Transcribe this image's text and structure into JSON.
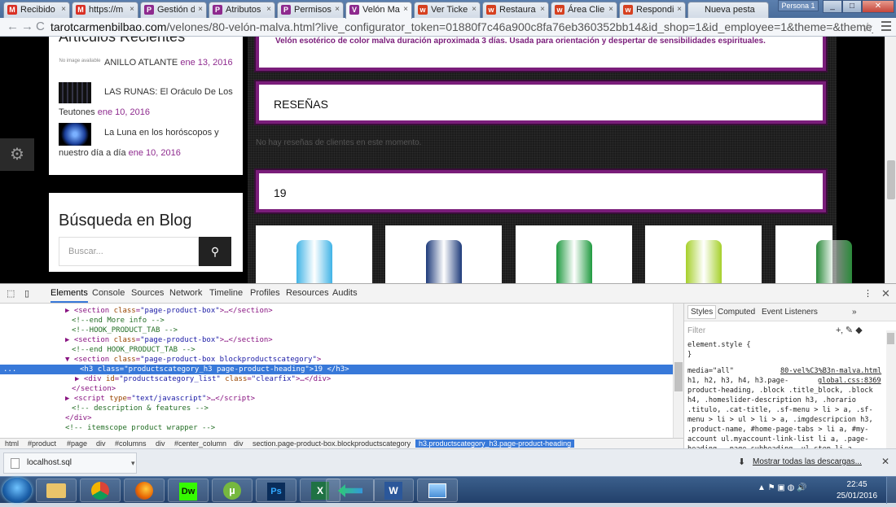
{
  "browser": {
    "tabs": [
      {
        "icon": "gmail-icon",
        "label": "Recibido",
        "color": "#d93025",
        "glyph": "M"
      },
      {
        "icon": "gmail-icon",
        "label": "https://m",
        "color": "#d93025",
        "glyph": "M"
      },
      {
        "icon": "prestashop-icon",
        "label": "Gestión d",
        "color": "#8e2a8e",
        "glyph": "P"
      },
      {
        "icon": "prestashop-icon",
        "label": "Atributos",
        "color": "#8e2a8e",
        "glyph": "P"
      },
      {
        "icon": "prestashop-icon",
        "label": "Permisos",
        "color": "#8e2a8e",
        "glyph": "P"
      },
      {
        "icon": "prestashop-icon",
        "label": "Velón Ma",
        "color": "#8e2a8e",
        "glyph": "V"
      },
      {
        "icon": "wix-icon",
        "label": "Ver Ticke",
        "color": "#d6401f",
        "glyph": "w"
      },
      {
        "icon": "wix-icon",
        "label": "Restaura",
        "color": "#d6401f",
        "glyph": "w"
      },
      {
        "icon": "wix-icon",
        "label": "Área Clie",
        "color": "#d6401f",
        "glyph": "w"
      },
      {
        "icon": "wix-icon",
        "label": "Respondi",
        "color": "#d6401f",
        "glyph": "w"
      },
      {
        "icon": "",
        "label": "Nueva pesta",
        "color": "",
        "glyph": ""
      }
    ],
    "profile": "Persona 1",
    "url_host": "tarotcarmenbilbao.com",
    "url_path": "/velones/80-velón-malva.html?live_configurator_token=01880f7c46a900c8fa76eb360352bb14&id_shop=1&id_employee=1&theme=&theme_fon"
  },
  "page": {
    "blog_heading_cut": "Artículos Recientes",
    "posts": [
      {
        "thumb": "No image available",
        "title": "ANILLO ATLANTE",
        "date": "ene 13, 2016"
      },
      {
        "thumb": "",
        "title": "LAS RUNAS: El Oráculo De Los Teutones",
        "date": "ene 10, 2016"
      },
      {
        "thumb": "",
        "title": "La Luna en los horóscopos y nuestro día a día",
        "date": "ene 10, 2016"
      }
    ],
    "search_title": "Búsqueda en Blog",
    "search_placeholder": "Buscar...",
    "description": "Velón esotérico de color malva duración aproximada 3 días. Usada para orientación y despertar de sensibilidades espirituales.",
    "reviews_heading": "RESEÑAS",
    "no_reviews": "No hay reseñas de clientes en este momento.",
    "category_count_heading": "19",
    "products": [
      {
        "color": "#3fb3e6"
      },
      {
        "color": "#1d3a7a"
      },
      {
        "color": "#1f9a3f"
      },
      {
        "color": "#a6d02a"
      },
      {
        "color": "#2a8a3a"
      }
    ]
  },
  "devtools": {
    "tabs": [
      "Elements",
      "Console",
      "Sources",
      "Network",
      "Timeline",
      "Profiles",
      "Resources",
      "Audits"
    ],
    "active_tab": "Elements",
    "dom_lines": [
      {
        "indent": 80,
        "html": "▶ <span class='tag'>&lt;section</span> <span class='attr'>class</span>=<span class='val'>\"page-product-box\"</span><span class='tag'>&gt;</span>…<span class='tag'>&lt;/section&gt;</span>"
      },
      {
        "indent": 88,
        "html": "<span class='c'>&lt;!--end  More info --&gt;</span>"
      },
      {
        "indent": 88,
        "html": "<span class='c'>&lt;!--HOOK_PRODUCT_TAB --&gt;</span>"
      },
      {
        "indent": 80,
        "html": "▶ <span class='tag'>&lt;section</span> <span class='attr'>class</span>=<span class='val'>\"page-product-box\"</span><span class='tag'>&gt;</span>…<span class='tag'>&lt;/section&gt;</span>"
      },
      {
        "indent": 88,
        "html": "<span class='c'>&lt;!--end HOOK_PRODUCT_TAB --&gt;</span>"
      },
      {
        "indent": 80,
        "html": "▼ <span class='tag'>&lt;section</span> <span class='attr'>class</span>=<span class='val'>\"page-product-box blockproductscategory\"</span><span class='tag'>&gt;</span>"
      },
      {
        "indent": 98,
        "html": "<span class='tag'>&lt;h3</span> <span class='attr'>class</span>=<span class='val'>\"productscategory_h3 page-product-heading\"</span><span class='tag'>&gt;</span><span class='txtn'>19 </span><span class='tag'>&lt;/h3&gt;</span>",
        "selected": true
      },
      {
        "indent": 92,
        "html": "▶ <span class='tag'>&lt;div</span> <span class='attr'>id</span>=<span class='val'>\"productscategory_list\"</span> <span class='attr'>class</span>=<span class='val'>\"clearfix\"</span><span class='tag'>&gt;</span>…<span class='tag'>&lt;/div&gt;</span>"
      },
      {
        "indent": 88,
        "html": "<span class='tag'>&lt;/section&gt;</span>"
      },
      {
        "indent": 80,
        "html": "▶ <span class='tag'>&lt;script</span> <span class='attr'>type</span>=<span class='val'>\"text/javascript\"</span><span class='tag'>&gt;</span>…<span class='tag'>&lt;/script&gt;</span>"
      },
      {
        "indent": 88,
        "html": "<span class='c'>&lt;!-- description &amp; features --&gt;</span>"
      },
      {
        "indent": 80,
        "html": "<span class='tag'>&lt;/div&gt;</span>"
      },
      {
        "indent": 80,
        "html": "<span class='c'>&lt;!-- itemscope product wrapper --&gt;</span>"
      }
    ],
    "breadcrumbs": [
      "html",
      "#product",
      "#page",
      "div",
      "#columns",
      "div",
      "#center_column",
      "div",
      "section.page-product-box.blockproductscategory",
      "h3.productscategory_h3.page-product-heading"
    ],
    "styles_tabs": [
      "Styles",
      "Computed",
      "Event Listeners"
    ],
    "filter_placeholder": "Filter",
    "style_lines": [
      "element.style {",
      "}",
      "media=\"all\"",
      "h1, h2, h3, h4, h3.page-",
      "product-heading, .block .title_block, .block",
      "h4, .homeslider-description h3, .horario",
      ".titulo, .cat-title, .sf-menu > li > a, .sf-",
      "menu > li > ul > li > a, .imgdescripcion h3,",
      ".product-name, #home-page-tabs > li a, #my-",
      "account ul.myaccount-link-list li a, .page-",
      "heading, .page-subheading, ul.step li a,"
    ],
    "style_link_1": "80-vel%C3%B3n-malva.html",
    "style_link_2": "global.css:8369"
  },
  "downloads": {
    "file": "localhost.sql",
    "show_all": "Mostrar todas las descargas..."
  },
  "taskbar": {
    "apps": [
      "",
      "",
      "",
      "Dw",
      "",
      "Ps",
      "",
      "",
      "W",
      ""
    ],
    "time": "22:45",
    "date": "25/01/2016"
  }
}
